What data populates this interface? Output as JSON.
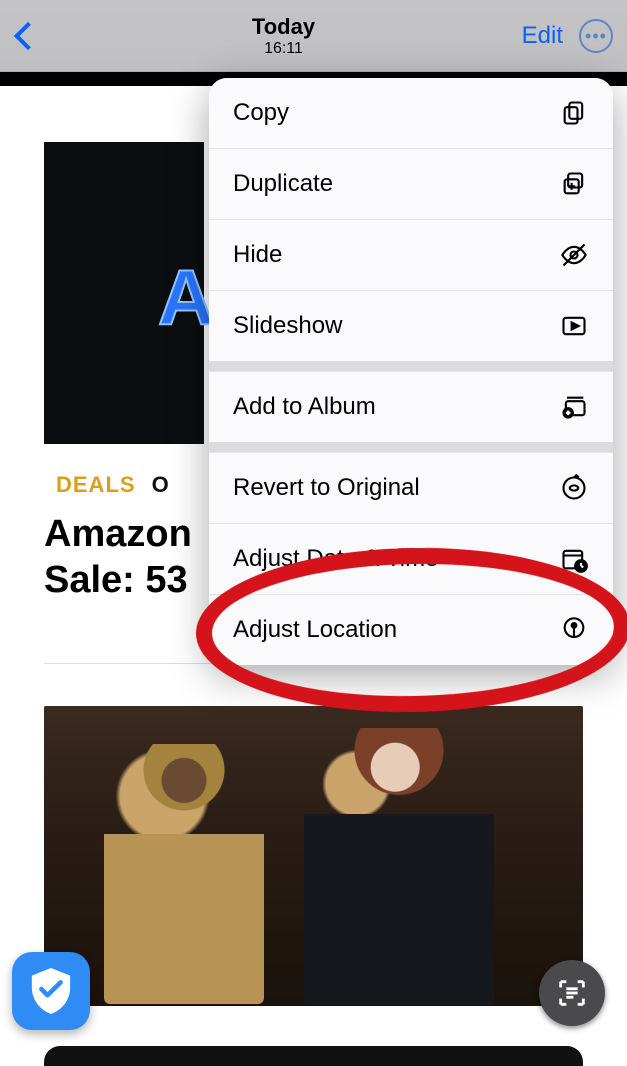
{
  "nav": {
    "title": "Today",
    "subtitle": "16:11",
    "edit_label": "Edit"
  },
  "content": {
    "neon_letter": "A",
    "deals_label": "DEALS",
    "deals_partial": "O",
    "headline_line1": "Amazon",
    "headline_line2": "Sale: 53"
  },
  "menu": {
    "copy": "Copy",
    "duplicate": "Duplicate",
    "hide": "Hide",
    "slideshow": "Slideshow",
    "add_to_album": "Add to Album",
    "revert": "Revert to Original",
    "adjust_date": "Adjust Date & Time",
    "adjust_location": "Adjust Location"
  }
}
